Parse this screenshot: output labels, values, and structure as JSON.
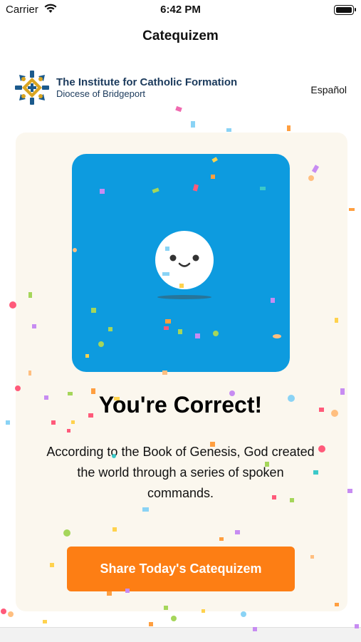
{
  "status_bar": {
    "carrier": "Carrier",
    "time": "6:42 PM"
  },
  "nav": {
    "title": "Catequizem"
  },
  "header": {
    "org_name": "The Institute for Catholic Formation",
    "org_subtitle": "Diocese of Bridgeport",
    "language_link": "Español"
  },
  "result": {
    "title": "You're Correct!",
    "explanation": "According to the Book of Genesis, God created the world through a series of spoken commands."
  },
  "share": {
    "label": "Share Today's Catequizem"
  },
  "colors": {
    "accent_orange": "#fd7e14",
    "image_blue": "#0d9bdf",
    "brand_navy": "#1b3a5c",
    "card_bg": "#fbf7ee"
  },
  "icons": [
    "wifi-icon",
    "battery-icon",
    "institute-logo",
    "smiley-mascot",
    "confetti-decoration"
  ]
}
